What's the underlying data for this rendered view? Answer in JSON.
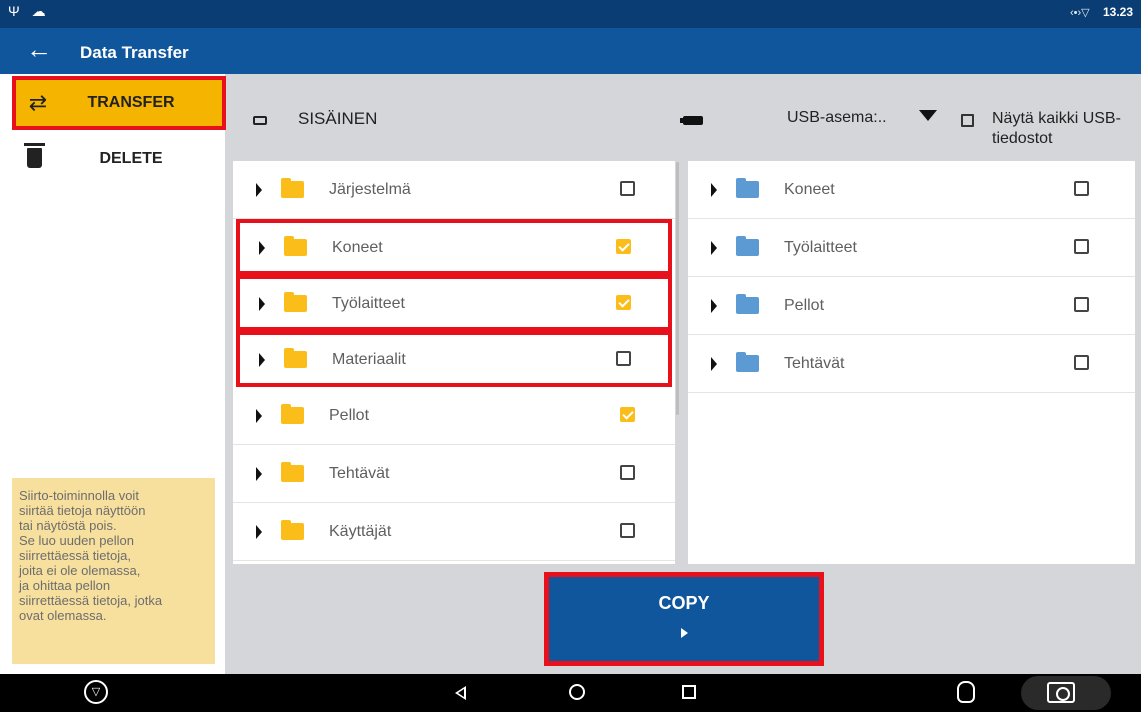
{
  "status_bar": {
    "left_icons": "Ψ ☁",
    "network": "‹•›▽",
    "time": "13.23"
  },
  "app_bar": {
    "back_icon": "arrow-left",
    "title": "Data Transfer"
  },
  "sidebar": {
    "items": [
      {
        "label": "TRANSFER",
        "icon": "transfer-arrows-icon",
        "icon_glyph": "⇄",
        "selected": true
      },
      {
        "label": "DELETE",
        "icon": "trash-icon",
        "selected": false
      }
    ],
    "info_text": "Siirto-toiminnolla voit\nsiirtää tietoja näyttöön\ntai näytöstä pois.\nSe luo uuden pellon\nsiirrettäessä tietoja,\njoita ei ole olemassa,\nja ohittaa pellon\nsiirrettäessä tietoja, jotka\novat olemassa."
  },
  "internal": {
    "label": "SISÄINEN",
    "items": [
      {
        "label": "Järjestelmä",
        "checked": false
      },
      {
        "label": "Koneet",
        "checked": true
      },
      {
        "label": "Työlaitteet",
        "checked": true
      },
      {
        "label": "Materiaalit",
        "checked": false
      },
      {
        "label": "Pellot",
        "checked": true
      },
      {
        "label": "Tehtävät",
        "checked": false
      },
      {
        "label": "Käyttäjät",
        "checked": false
      }
    ]
  },
  "usb": {
    "drive_label": "USB-asema:..",
    "show_all_label": "Näytä kaikki USB-tiedostot",
    "show_all_checked": false,
    "items": [
      {
        "label": "Koneet",
        "checked": false
      },
      {
        "label": "Työlaitteet",
        "checked": false
      },
      {
        "label": "Pellot",
        "checked": false
      },
      {
        "label": "Tehtävät",
        "checked": false
      }
    ]
  },
  "copy_button": {
    "label": "COPY"
  },
  "nav_bar": {
    "icons": [
      "hv-logo-icon",
      "back-icon",
      "home-icon",
      "recents-icon",
      "bug-icon",
      "camera-icon"
    ]
  },
  "colors": {
    "status_bar": "#0b3d75",
    "app_bar": "#0f569c",
    "accent_yellow": "#f5b400",
    "highlight_red": "#e8101a",
    "folder_yellow": "#fbbd19",
    "folder_blue": "#5c9ad4",
    "info_bg": "#f7e09e"
  }
}
